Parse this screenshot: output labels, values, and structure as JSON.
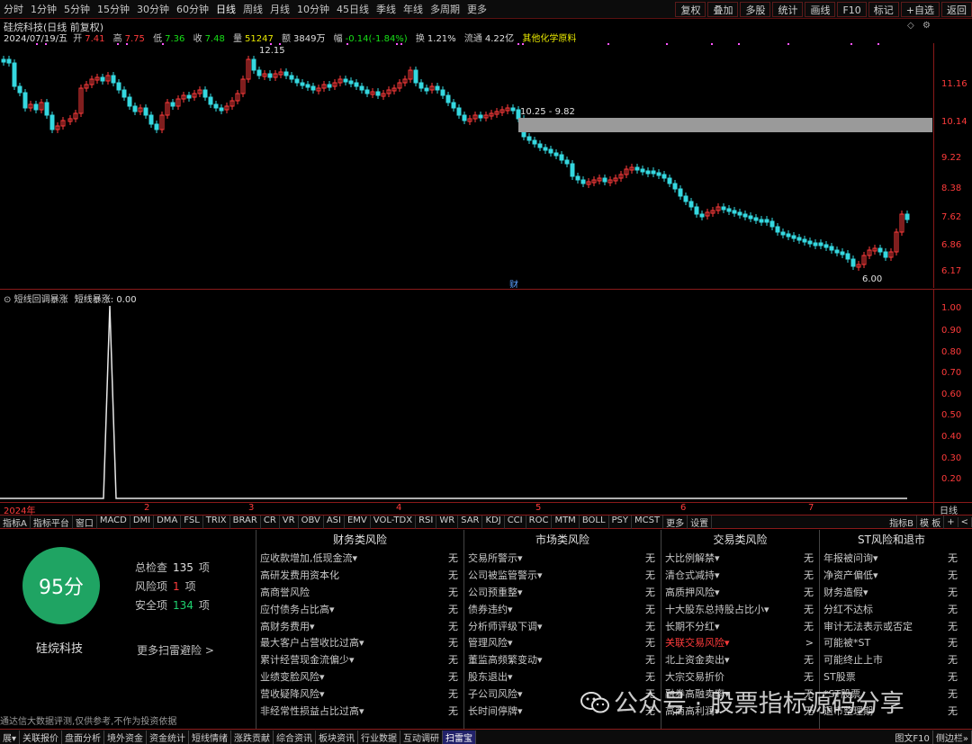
{
  "toolbar": {
    "periods": [
      "分时",
      "1分钟",
      "5分钟",
      "15分钟",
      "30分钟",
      "60分钟",
      "日线",
      "周线",
      "月线",
      "10分钟",
      "45日线",
      "季线",
      "年线",
      "多周期",
      "更多"
    ],
    "active_period": "日线",
    "right_buttons": [
      "复权",
      "叠加",
      "多股",
      "统计",
      "画线",
      "F10",
      "标记",
      "+自选",
      "返回"
    ]
  },
  "stock": {
    "title": "硅烷科技(日线 前复权)",
    "date": "2024/07/19/五",
    "open_label": "开",
    "open": "7.41",
    "high_label": "高",
    "high": "7.75",
    "low_label": "低",
    "low": "7.36",
    "close_label": "收",
    "close": "7.48",
    "vol_label": "量",
    "vol": "51247",
    "amount_label": "额",
    "amount": "3849万",
    "change_label": "幅",
    "change": "-0.14(-1.84%)",
    "turnover_label": "换",
    "turnover": "1.21%",
    "float_label": "流通",
    "float": "4.22亿",
    "sector": "其他化学原料"
  },
  "main_chart": {
    "price_axis": [
      "11.16",
      "10.14",
      "9.22",
      "8.38",
      "7.62",
      "6.86",
      "6.17"
    ],
    "annotations": {
      "high": "12.15",
      "gap": "10.25 - 9.82",
      "low": "6.00",
      "event": "财"
    }
  },
  "sub_chart": {
    "title": "短线回调暴涨",
    "series_label": "短线暴涨: 0.00",
    "axis": [
      "1.00",
      "0.90",
      "0.80",
      "0.70",
      "0.60",
      "0.50",
      "0.40",
      "0.30",
      "0.20"
    ]
  },
  "date_axis": {
    "labels": [
      "2024年",
      "2",
      "3",
      "4",
      "5",
      "6",
      "7"
    ],
    "right": "日线"
  },
  "indicator_bar": {
    "tabs": [
      "指标A",
      "指标平台",
      "窗口",
      "MACD",
      "DMI",
      "DMA",
      "FSL",
      "TRIX",
      "BRAR",
      "CR",
      "VR",
      "OBV",
      "ASI",
      "EMV",
      "VOL-TDX",
      "RSI",
      "WR",
      "SAR",
      "KDJ",
      "CCI",
      "ROC",
      "MTM",
      "BOLL",
      "PSY",
      "MCST",
      "更多",
      "设置"
    ],
    "right": [
      "指标B",
      "模 板",
      "+",
      "<"
    ]
  },
  "risk_panel": {
    "score": "95分",
    "company": "硅烷科技",
    "total_label": "总检查",
    "total": "135",
    "risk_label": "风险项",
    "risk": "1",
    "safe_label": "安全项",
    "safe": "134",
    "unit": "项",
    "more": "更多扫雷避险 >",
    "columns": [
      {
        "title": "财务类风险",
        "rows": [
          {
            "name": "应收款增加,低现金流▾",
            "status": "无"
          },
          {
            "name": "高研发费用资本化",
            "status": "无"
          },
          {
            "name": "高商誉风险",
            "status": "无"
          },
          {
            "name": "应付债务占比高▾",
            "status": "无"
          },
          {
            "name": "高财务费用▾",
            "status": "无"
          },
          {
            "name": "最大客户占营收比过高▾",
            "status": "无"
          },
          {
            "name": "累计经营现金流偏少▾",
            "status": "无"
          },
          {
            "name": "业绩变脸风险▾",
            "status": "无"
          },
          {
            "name": "营收疑降风险▾",
            "status": "无"
          },
          {
            "name": "非经常性损益占比过高▾",
            "status": "无"
          }
        ]
      },
      {
        "title": "市场类风险",
        "rows": [
          {
            "name": "交易所警示▾",
            "status": "无"
          },
          {
            "name": "公司被监管警示▾",
            "status": "无"
          },
          {
            "name": "公司预重整▾",
            "status": "无"
          },
          {
            "name": "债券违约▾",
            "status": "无"
          },
          {
            "name": "分析师评级下调▾",
            "status": "无"
          },
          {
            "name": "管理风险▾",
            "status": "无"
          },
          {
            "name": "董监高频繁变动▾",
            "status": "无"
          },
          {
            "name": "股东退出▾",
            "status": "无"
          },
          {
            "name": "子公司风险▾",
            "status": "无"
          },
          {
            "name": "长时间停牌▾",
            "status": "无"
          }
        ]
      },
      {
        "title": "交易类风险",
        "rows": [
          {
            "name": "大比例解禁▾",
            "status": "无"
          },
          {
            "name": "清仓式减持▾",
            "status": "无"
          },
          {
            "name": "高质押风险▾",
            "status": "无"
          },
          {
            "name": "十大股东总持股占比小▾",
            "status": "无"
          },
          {
            "name": "长期不分红▾",
            "status": "无"
          },
          {
            "name": "关联交易风险▾",
            "status": ">",
            "highlight": true
          },
          {
            "name": "北上资金卖出▾",
            "status": "无"
          },
          {
            "name": "大宗交易折价",
            "status": "无"
          },
          {
            "name": "融券高融卖率▾",
            "status": "无"
          },
          {
            "name": "高商高利润▾",
            "status": "无"
          }
        ]
      },
      {
        "title": "ST风险和退市",
        "rows": [
          {
            "name": "年报被问询▾",
            "status": "无"
          },
          {
            "name": "净资产偏低▾",
            "status": "无"
          },
          {
            "name": "财务造假▾",
            "status": "无"
          },
          {
            "name": "分红不达标",
            "status": "无"
          },
          {
            "name": "审计无法表示或否定",
            "status": "无"
          },
          {
            "name": "可能被*ST",
            "status": "无"
          },
          {
            "name": "可能终止上市",
            "status": "无"
          },
          {
            "name": "ST股票",
            "status": "无"
          },
          {
            "name": "*ST股票",
            "status": "无"
          },
          {
            "name": "退市整理期",
            "status": "无"
          }
        ]
      }
    ],
    "disclaimer": "通达信大数据评测,仅供参考,不作为投资依据"
  },
  "watermark": "公众号 · 股票指标源码分享",
  "status_bar": {
    "items": [
      "展▾",
      "关联报价",
      "盘面分析",
      "境外资金",
      "资金统计",
      "短线情绪",
      "涨跌贡献",
      "综合资讯",
      "板块资讯",
      "行业数据",
      "互动调研",
      "扫雷宝"
    ],
    "active": "扫雷宝",
    "right": [
      "图文F10",
      "侧边栏»"
    ]
  },
  "colors": {
    "up": "#ff3b3b",
    "down": "#35d8e0",
    "accent": "#8a1a1a",
    "score": "#1fa463"
  }
}
